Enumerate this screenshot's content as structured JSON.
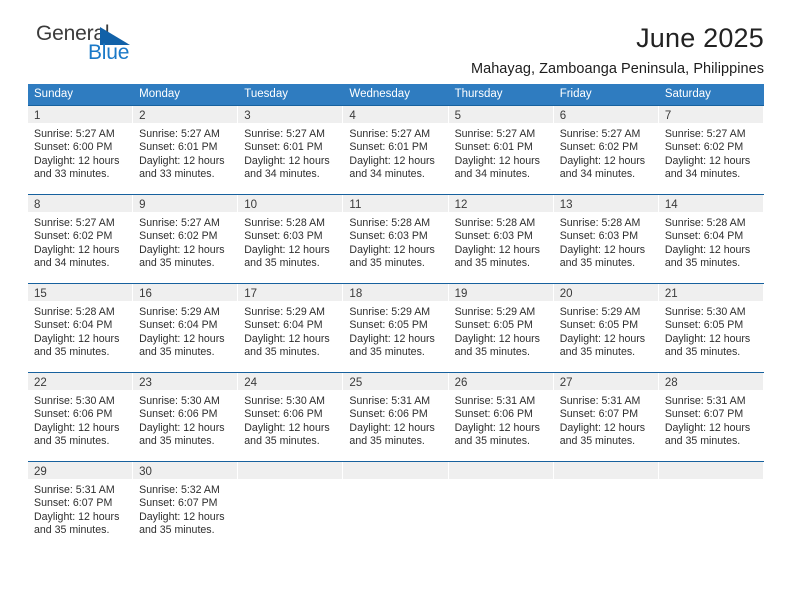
{
  "brand": {
    "name_part1": "General",
    "name_part2": "Blue",
    "accent_color": "#1a79c8",
    "triangle_color": "#1161a8"
  },
  "header": {
    "title": "June 2025",
    "subtitle": "Mahayag, Zamboanga Peninsula, Philippines"
  },
  "calendar": {
    "header_bg": "#2f7cc0",
    "row_rule_color": "#17619e",
    "day_band_bg": "#efefef",
    "weekday_headers": [
      "Sunday",
      "Monday",
      "Tuesday",
      "Wednesday",
      "Thursday",
      "Friday",
      "Saturday"
    ],
    "weeks": [
      [
        {
          "day": "1",
          "sunrise": "Sunrise: 5:27 AM",
          "sunset": "Sunset: 6:00 PM",
          "daylight1": "Daylight: 12 hours",
          "daylight2": "and 33 minutes."
        },
        {
          "day": "2",
          "sunrise": "Sunrise: 5:27 AM",
          "sunset": "Sunset: 6:01 PM",
          "daylight1": "Daylight: 12 hours",
          "daylight2": "and 33 minutes."
        },
        {
          "day": "3",
          "sunrise": "Sunrise: 5:27 AM",
          "sunset": "Sunset: 6:01 PM",
          "daylight1": "Daylight: 12 hours",
          "daylight2": "and 34 minutes."
        },
        {
          "day": "4",
          "sunrise": "Sunrise: 5:27 AM",
          "sunset": "Sunset: 6:01 PM",
          "daylight1": "Daylight: 12 hours",
          "daylight2": "and 34 minutes."
        },
        {
          "day": "5",
          "sunrise": "Sunrise: 5:27 AM",
          "sunset": "Sunset: 6:01 PM",
          "daylight1": "Daylight: 12 hours",
          "daylight2": "and 34 minutes."
        },
        {
          "day": "6",
          "sunrise": "Sunrise: 5:27 AM",
          "sunset": "Sunset: 6:02 PM",
          "daylight1": "Daylight: 12 hours",
          "daylight2": "and 34 minutes."
        },
        {
          "day": "7",
          "sunrise": "Sunrise: 5:27 AM",
          "sunset": "Sunset: 6:02 PM",
          "daylight1": "Daylight: 12 hours",
          "daylight2": "and 34 minutes."
        }
      ],
      [
        {
          "day": "8",
          "sunrise": "Sunrise: 5:27 AM",
          "sunset": "Sunset: 6:02 PM",
          "daylight1": "Daylight: 12 hours",
          "daylight2": "and 34 minutes."
        },
        {
          "day": "9",
          "sunrise": "Sunrise: 5:27 AM",
          "sunset": "Sunset: 6:02 PM",
          "daylight1": "Daylight: 12 hours",
          "daylight2": "and 35 minutes."
        },
        {
          "day": "10",
          "sunrise": "Sunrise: 5:28 AM",
          "sunset": "Sunset: 6:03 PM",
          "daylight1": "Daylight: 12 hours",
          "daylight2": "and 35 minutes."
        },
        {
          "day": "11",
          "sunrise": "Sunrise: 5:28 AM",
          "sunset": "Sunset: 6:03 PM",
          "daylight1": "Daylight: 12 hours",
          "daylight2": "and 35 minutes."
        },
        {
          "day": "12",
          "sunrise": "Sunrise: 5:28 AM",
          "sunset": "Sunset: 6:03 PM",
          "daylight1": "Daylight: 12 hours",
          "daylight2": "and 35 minutes."
        },
        {
          "day": "13",
          "sunrise": "Sunrise: 5:28 AM",
          "sunset": "Sunset: 6:03 PM",
          "daylight1": "Daylight: 12 hours",
          "daylight2": "and 35 minutes."
        },
        {
          "day": "14",
          "sunrise": "Sunrise: 5:28 AM",
          "sunset": "Sunset: 6:04 PM",
          "daylight1": "Daylight: 12 hours",
          "daylight2": "and 35 minutes."
        }
      ],
      [
        {
          "day": "15",
          "sunrise": "Sunrise: 5:28 AM",
          "sunset": "Sunset: 6:04 PM",
          "daylight1": "Daylight: 12 hours",
          "daylight2": "and 35 minutes."
        },
        {
          "day": "16",
          "sunrise": "Sunrise: 5:29 AM",
          "sunset": "Sunset: 6:04 PM",
          "daylight1": "Daylight: 12 hours",
          "daylight2": "and 35 minutes."
        },
        {
          "day": "17",
          "sunrise": "Sunrise: 5:29 AM",
          "sunset": "Sunset: 6:04 PM",
          "daylight1": "Daylight: 12 hours",
          "daylight2": "and 35 minutes."
        },
        {
          "day": "18",
          "sunrise": "Sunrise: 5:29 AM",
          "sunset": "Sunset: 6:05 PM",
          "daylight1": "Daylight: 12 hours",
          "daylight2": "and 35 minutes."
        },
        {
          "day": "19",
          "sunrise": "Sunrise: 5:29 AM",
          "sunset": "Sunset: 6:05 PM",
          "daylight1": "Daylight: 12 hours",
          "daylight2": "and 35 minutes."
        },
        {
          "day": "20",
          "sunrise": "Sunrise: 5:29 AM",
          "sunset": "Sunset: 6:05 PM",
          "daylight1": "Daylight: 12 hours",
          "daylight2": "and 35 minutes."
        },
        {
          "day": "21",
          "sunrise": "Sunrise: 5:30 AM",
          "sunset": "Sunset: 6:05 PM",
          "daylight1": "Daylight: 12 hours",
          "daylight2": "and 35 minutes."
        }
      ],
      [
        {
          "day": "22",
          "sunrise": "Sunrise: 5:30 AM",
          "sunset": "Sunset: 6:06 PM",
          "daylight1": "Daylight: 12 hours",
          "daylight2": "and 35 minutes."
        },
        {
          "day": "23",
          "sunrise": "Sunrise: 5:30 AM",
          "sunset": "Sunset: 6:06 PM",
          "daylight1": "Daylight: 12 hours",
          "daylight2": "and 35 minutes."
        },
        {
          "day": "24",
          "sunrise": "Sunrise: 5:30 AM",
          "sunset": "Sunset: 6:06 PM",
          "daylight1": "Daylight: 12 hours",
          "daylight2": "and 35 minutes."
        },
        {
          "day": "25",
          "sunrise": "Sunrise: 5:31 AM",
          "sunset": "Sunset: 6:06 PM",
          "daylight1": "Daylight: 12 hours",
          "daylight2": "and 35 minutes."
        },
        {
          "day": "26",
          "sunrise": "Sunrise: 5:31 AM",
          "sunset": "Sunset: 6:06 PM",
          "daylight1": "Daylight: 12 hours",
          "daylight2": "and 35 minutes."
        },
        {
          "day": "27",
          "sunrise": "Sunrise: 5:31 AM",
          "sunset": "Sunset: 6:07 PM",
          "daylight1": "Daylight: 12 hours",
          "daylight2": "and 35 minutes."
        },
        {
          "day": "28",
          "sunrise": "Sunrise: 5:31 AM",
          "sunset": "Sunset: 6:07 PM",
          "daylight1": "Daylight: 12 hours",
          "daylight2": "and 35 minutes."
        }
      ],
      [
        {
          "day": "29",
          "sunrise": "Sunrise: 5:31 AM",
          "sunset": "Sunset: 6:07 PM",
          "daylight1": "Daylight: 12 hours",
          "daylight2": "and 35 minutes."
        },
        {
          "day": "30",
          "sunrise": "Sunrise: 5:32 AM",
          "sunset": "Sunset: 6:07 PM",
          "daylight1": "Daylight: 12 hours",
          "daylight2": "and 35 minutes."
        },
        {
          "day": "",
          "sunrise": "",
          "sunset": "",
          "daylight1": "",
          "daylight2": ""
        },
        {
          "day": "",
          "sunrise": "",
          "sunset": "",
          "daylight1": "",
          "daylight2": ""
        },
        {
          "day": "",
          "sunrise": "",
          "sunset": "",
          "daylight1": "",
          "daylight2": ""
        },
        {
          "day": "",
          "sunrise": "",
          "sunset": "",
          "daylight1": "",
          "daylight2": ""
        },
        {
          "day": "",
          "sunrise": "",
          "sunset": "",
          "daylight1": "",
          "daylight2": ""
        }
      ]
    ]
  }
}
